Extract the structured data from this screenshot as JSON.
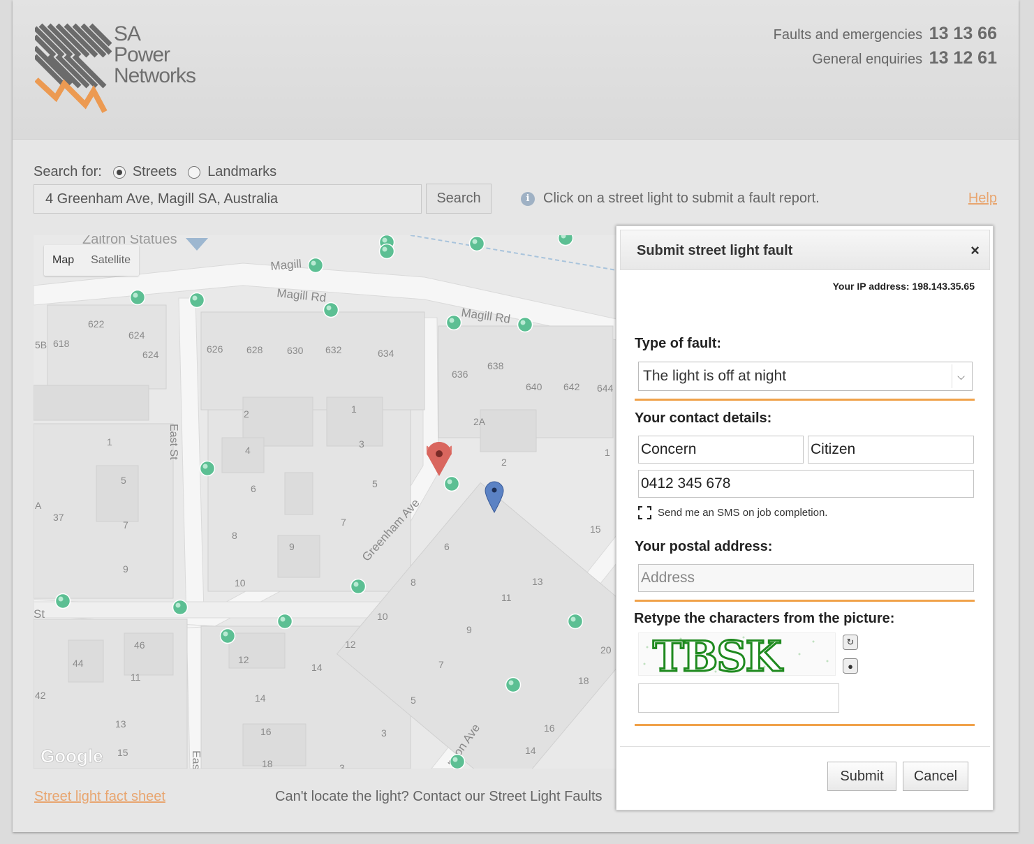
{
  "header": {
    "logo_line1": "SA",
    "logo_line2": "Power",
    "logo_line3": "Networks",
    "faults_label": "Faults and emergencies",
    "faults_number": "13 13 66",
    "enquiries_label": "General enquiries",
    "enquiries_number": "13 12 61"
  },
  "search": {
    "label": "Search for:",
    "options": [
      {
        "label": "Streets",
        "selected": true
      },
      {
        "label": "Landmarks",
        "selected": false
      }
    ],
    "value": "4 Greenham Ave, Magill SA, Australia",
    "button": "Search",
    "info_text": "Click on a street light to submit a fault report.",
    "help_link": "Help"
  },
  "map": {
    "type_options": [
      "Map",
      "Satellite"
    ],
    "active_type": "Map",
    "attribution": "Google",
    "landmark": "Zaitron Statues",
    "streets": {
      "magill1": "Magill",
      "magill2": "Magill Rd",
      "magill3": "Magill Rd",
      "east_st": "East St",
      "greenham": "Greenham Ave",
      "lawson": "nson Ave",
      "east2": "Eas",
      "st": "St"
    },
    "lot_numbers": [
      "622",
      "624",
      "624",
      "618",
      "626",
      "628",
      "630",
      "632",
      "634",
      "636",
      "638",
      "640",
      "642",
      "644",
      "2A",
      "2",
      "1",
      "3",
      "2",
      "4",
      "1",
      "5",
      "6",
      "5",
      "7",
      "37",
      "7",
      "8",
      "9",
      "6",
      "9",
      "10",
      "8",
      "13",
      "11",
      "15",
      "10",
      "9",
      "12",
      "20",
      "46",
      "44",
      "11",
      "12",
      "14",
      "7",
      "18",
      "42",
      "13",
      "14",
      "5",
      "16",
      "16",
      "15",
      "3",
      "14",
      "18",
      "3",
      "1",
      "A",
      "5B"
    ]
  },
  "footer": {
    "fact_sheet_link": "Street light fact sheet",
    "cant_locate": "Can't locate the light? Contact our Street Light Faults"
  },
  "dialog": {
    "title": "Submit street light fault",
    "close_glyph": "×",
    "ip_label": "Your IP address: 198.143.35.65",
    "fault_type_label": "Type of fault:",
    "fault_type_value": "The light is off at night",
    "contact_label": "Your contact details:",
    "first_name": "Concern",
    "last_name": "Citizen",
    "phone": "0412 345 678",
    "sms_label": "Send me an SMS on job completion.",
    "postal_label": "Your postal address:",
    "address_placeholder": "Address",
    "captcha_label": "Retype the characters from the picture:",
    "captcha_text": "TBSK",
    "captcha_input_value": "",
    "submit": "Submit",
    "cancel": "Cancel"
  },
  "colors": {
    "accent_orange": "#f0a24a",
    "link_orange": "#e8a56f",
    "light_marker": "#5cbf93",
    "selected_marker": "#d9534f",
    "location_marker": "#4a73b5"
  }
}
